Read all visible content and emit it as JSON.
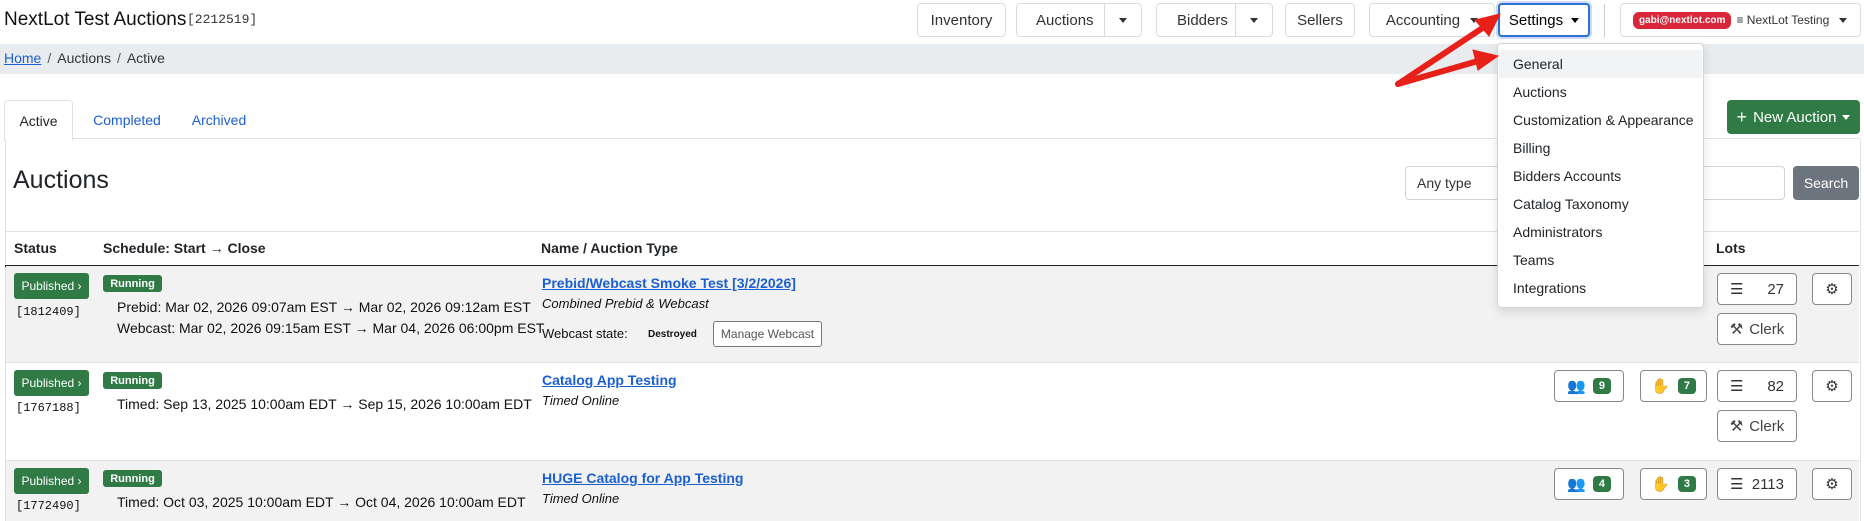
{
  "header": {
    "title": "NextLot Test Auctions",
    "id": "[2212519]",
    "nav": {
      "inventory": "Inventory",
      "auctions": "Auctions",
      "bidders": "Bidders",
      "sellers": "Sellers",
      "accounting": "Accounting",
      "settings": "Settings"
    },
    "user_email": "gabi@nextlot.com",
    "tenant": "≡ NextLot Testing"
  },
  "breadcrumb": {
    "home": "Home",
    "auctions": "Auctions",
    "active": "Active",
    "separator": "/"
  },
  "tabs": [
    "Active",
    "Completed",
    "Archived"
  ],
  "new_auction_label": "New Auction",
  "page_title": "Auctions",
  "filter": {
    "type_value": "Any type",
    "search_label": "Search"
  },
  "table": {
    "headers": {
      "status": "Status",
      "schedule": "Schedule: Start → Close",
      "name": "Name / Auction Type",
      "lots": "Lots"
    },
    "rows": [
      {
        "status": "Published ›",
        "id": "[1812409]",
        "state": "Running",
        "schedule": [
          "Prebid: Mar 02, 2026 09:07am EST → Mar 02, 2026 09:12am EST",
          "Webcast: Mar 02, 2026 09:15am EST → Mar 04, 2026 06:00pm EST"
        ],
        "name": "Prebid/Webcast Smoke Test [3/2/2026]",
        "type": "Combined Prebid & Webcast",
        "webcast_state_label": "Webcast state:",
        "webcast_state": "Destroyed",
        "manage_label": "Manage Webcast",
        "lots": "27",
        "clerk": "Clerk"
      },
      {
        "status": "Published ›",
        "id": "[1767188]",
        "state": "Running",
        "schedule": [
          "Timed: Sep 13, 2025 10:00am EDT → Sep 15, 2026 10:00am EDT"
        ],
        "name": "Catalog App Testing",
        "type": "Timed Online",
        "bidders_count": "9",
        "registrations_count": "7",
        "lots": "82",
        "clerk": "Clerk"
      },
      {
        "status": "Published ›",
        "id": "[1772490]",
        "state": "Running",
        "schedule": [
          "Timed: Oct 03, 2025 10:00am EDT → Oct 04, 2026 10:00am EDT"
        ],
        "name": "HUGE Catalog for App Testing",
        "type": "Timed Online",
        "bidders_count": "4",
        "registrations_count": "3",
        "lots": "2113"
      }
    ]
  },
  "settings_menu": {
    "items": [
      "General",
      "Auctions",
      "Customization & Appearance",
      "Billing",
      "Bidders Accounts",
      "Catalog Taxonomy",
      "Administrators",
      "Teams",
      "Integrations"
    ],
    "highlighted": "General"
  },
  "colors": {
    "primary_green": "#2f7a45",
    "link_blue": "#1c5fd1",
    "annotation_red": "#e8201a",
    "user_badge_red": "#d9263a"
  }
}
